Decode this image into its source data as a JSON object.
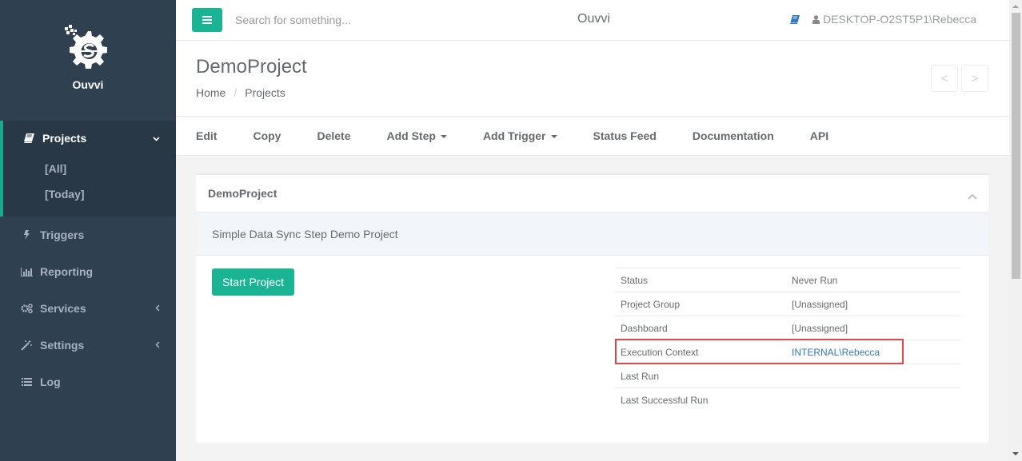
{
  "app": {
    "name": "Ouvvi",
    "brand_color": "#1ab394",
    "sidebar_color": "#2f4050"
  },
  "sidebar": {
    "logo_text": "Ouvvi",
    "items": [
      {
        "label": "Projects",
        "icon": "book-icon",
        "expanded": true,
        "arrow": "chevron-down",
        "children": [
          {
            "label": "[All]"
          },
          {
            "label": "[Today]"
          }
        ]
      },
      {
        "label": "Triggers",
        "icon": "bolt-icon"
      },
      {
        "label": "Reporting",
        "icon": "bar-chart-icon"
      },
      {
        "label": "Services",
        "icon": "gears-icon",
        "arrow": "chevron-left"
      },
      {
        "label": "Settings",
        "icon": "magic-wand-icon",
        "arrow": "chevron-left"
      },
      {
        "label": "Log",
        "icon": "list-icon"
      }
    ]
  },
  "topbar": {
    "search_placeholder": "Search for something...",
    "brand": "Ouvvi",
    "user": "DESKTOP-O2ST5P1\\Rebecca"
  },
  "heading": {
    "title": "DemoProject",
    "breadcrumb": [
      "Home",
      "Projects"
    ],
    "separator": "/",
    "prev_label": "<",
    "next_label": ">"
  },
  "toolbar": {
    "items": [
      {
        "label": "Edit"
      },
      {
        "label": "Copy"
      },
      {
        "label": "Delete"
      },
      {
        "label": "Add Step",
        "dropdown": true
      },
      {
        "label": "Add Trigger",
        "dropdown": true
      },
      {
        "label": "Status Feed"
      },
      {
        "label": "Documentation"
      },
      {
        "label": "API"
      }
    ]
  },
  "panel": {
    "title": "DemoProject",
    "description": "Simple Data Sync Step Demo Project",
    "start_button": "Start Project",
    "details": [
      {
        "key": "Status",
        "value": "Never Run"
      },
      {
        "key": "Project Group",
        "value": "[Unassigned]"
      },
      {
        "key": "Dashboard",
        "value": "[Unassigned]"
      },
      {
        "key": "Execution Context",
        "value": "INTERNAL\\Rebecca",
        "link": true,
        "highlighted": true
      },
      {
        "key": "Last Run",
        "value": ""
      },
      {
        "key": "Last Successful Run",
        "value": ""
      }
    ]
  }
}
